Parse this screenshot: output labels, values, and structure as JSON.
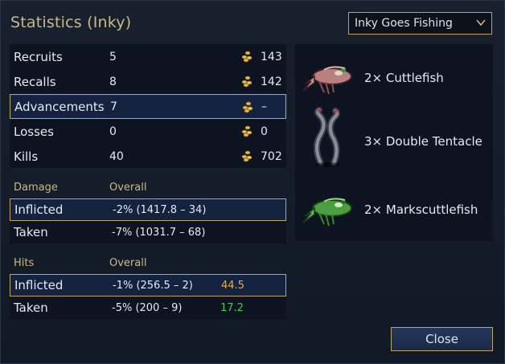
{
  "dialog": {
    "title": "Statistics (Inky)",
    "scenario_select": {
      "value": "Inky Goes Fishing"
    }
  },
  "stats": {
    "rows": [
      {
        "label": "Recruits",
        "value": "5",
        "cost": "143"
      },
      {
        "label": "Recalls",
        "value": "8",
        "cost": "142"
      },
      {
        "label": "Advancements",
        "value": "7",
        "cost": "–"
      },
      {
        "label": "Losses",
        "value": "0",
        "cost": "0"
      },
      {
        "label": "Kills",
        "value": "40",
        "cost": "702"
      }
    ],
    "highlighted_row": "Advancements"
  },
  "damage": {
    "heading": "Damage",
    "overall_label": "Overall",
    "rows": [
      {
        "label": "Inflicted",
        "value": "-2% (1417.8 – 34)"
      },
      {
        "label": "Taken",
        "value": "-7% (1031.7 – 68)"
      }
    ]
  },
  "hits": {
    "heading": "Hits",
    "overall_label": "Overall",
    "rows": [
      {
        "label": "Inflicted",
        "value": "-1% (256.5 – 2)",
        "extra": "44.5",
        "extra_color": "#e0b040"
      },
      {
        "label": "Taken",
        "value": "-5% (200 – 9)",
        "extra": "17.2",
        "extra_color": "#3fcf3f"
      }
    ]
  },
  "kills_list": [
    {
      "text": "2× Cuttlefish",
      "icon": "cuttlefish-icon"
    },
    {
      "text": "3× Double Tentacle",
      "icon": "double-tentacle-icon"
    },
    {
      "text": "2× Markscuttlefish",
      "icon": "markscuttlefish-icon"
    }
  ],
  "footer": {
    "close_label": "Close"
  },
  "colors": {
    "accent_gold": "#bfa460",
    "title_gold": "#c9b98a",
    "highlight_bg": "#142240",
    "panel_bg": "#0d1320"
  }
}
